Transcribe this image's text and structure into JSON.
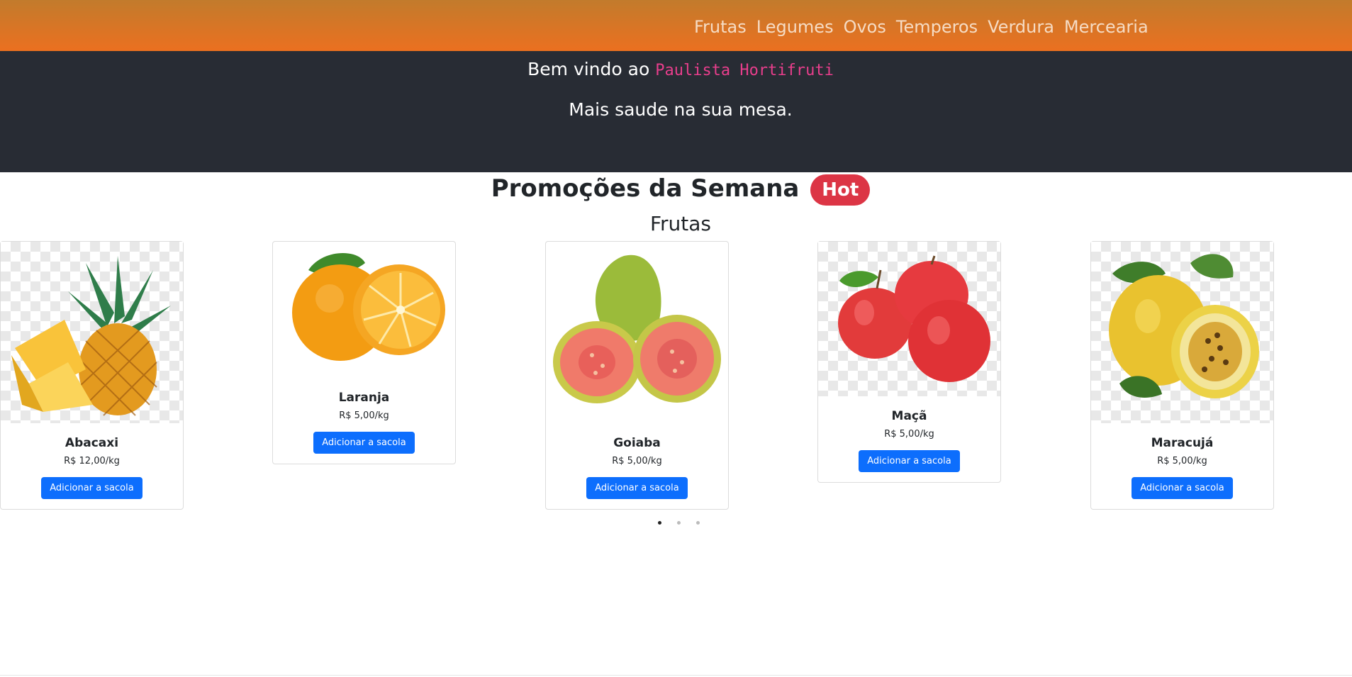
{
  "nav": {
    "links": [
      "Frutas",
      "Legumes",
      "Ovos",
      "Temperos",
      "Verdura",
      "Mercearia"
    ]
  },
  "hero": {
    "welcome_prefix": "Bem vindo ao",
    "brand": "Paulista Hortifruti",
    "slogan": "Mais saude na sua mesa."
  },
  "promo": {
    "title": "Promoções da Semana",
    "badge": "Hot",
    "category": "Frutas"
  },
  "products": [
    {
      "name": "Abacaxi",
      "price": "R$ 12,00/kg",
      "button": "Adicionar a sacola",
      "icon": "pineapple-image"
    },
    {
      "name": "Laranja",
      "price": "R$ 5,00/kg",
      "button": "Adicionar a sacola",
      "icon": "orange-image"
    },
    {
      "name": "Goiaba",
      "price": "R$ 5,00/kg",
      "button": "Adicionar a sacola",
      "icon": "guava-image"
    },
    {
      "name": "Maçã",
      "price": "R$ 5,00/kg",
      "button": "Adicionar a sacola",
      "icon": "apple-image"
    },
    {
      "name": "Maracujá",
      "price": "R$ 5,00/kg",
      "button": "Adicionar a sacola",
      "icon": "passion-fruit-image"
    }
  ],
  "carousel": {
    "pages": 3,
    "active": 1
  },
  "colors": {
    "nav_gradient_top": "#c27b2c",
    "nav_gradient_bottom": "#eb7020",
    "hero_bg": "#282c34",
    "brand": "#e83e8c",
    "badge": "#dc3545",
    "button": "#0d6efd"
  }
}
